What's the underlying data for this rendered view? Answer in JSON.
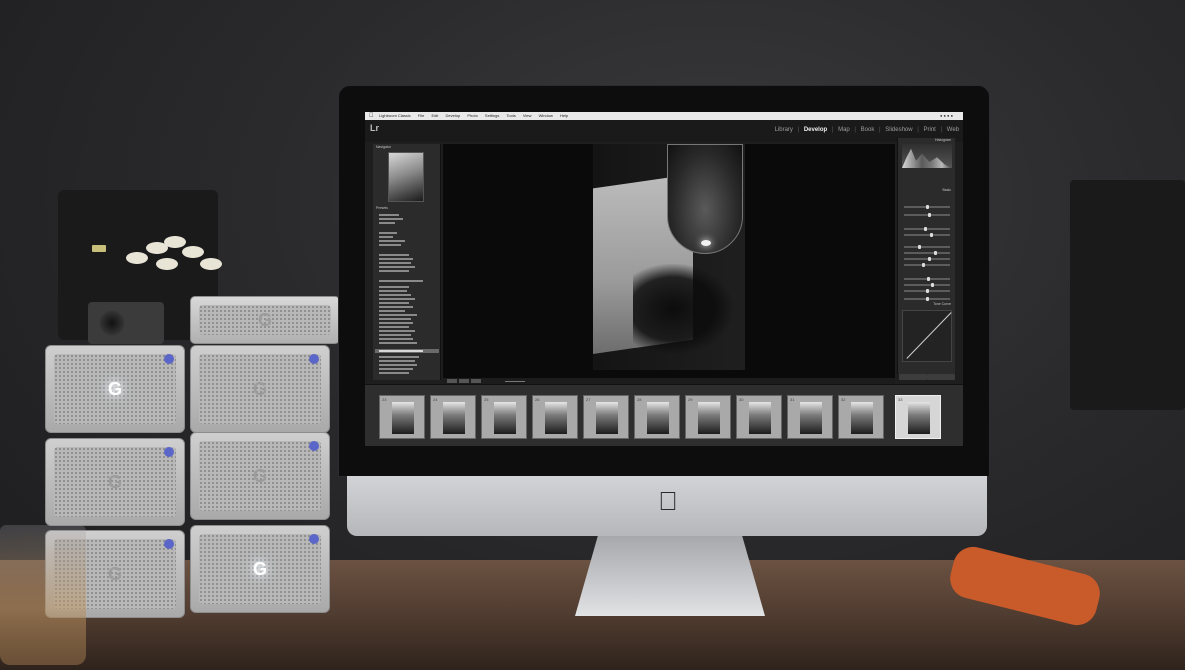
{
  "menubar": {
    "items": [
      "Lightroom Classic",
      "File",
      "Edit",
      "Develop",
      "Photo",
      "Settings",
      "Tools",
      "View",
      "Window",
      "Help"
    ]
  },
  "lightroom": {
    "logo": "Lr",
    "modules": [
      {
        "label": "Library",
        "active": false
      },
      {
        "label": "Develop",
        "active": true
      },
      {
        "label": "Map",
        "active": false
      },
      {
        "label": "Book",
        "active": false
      },
      {
        "label": "Print",
        "active": false
      },
      {
        "label": "Slideshow",
        "active": false
      },
      {
        "label": "Web",
        "active": false
      }
    ],
    "left_panel": {
      "navigator_title": "Navigator",
      "presets_title": "Presets"
    },
    "right_panel": {
      "histogram_title": "Histogram",
      "basic_title": "Basic",
      "tone_curve_title": "Tone Curve"
    },
    "filmstrip": {
      "frame_numbers": [
        "23",
        "24",
        "25",
        "26",
        "27",
        "28",
        "29",
        "30",
        "31",
        "32",
        "33"
      ],
      "selected_index": 10
    }
  },
  "scene": {
    "drive_logo": "G",
    "apple_logo": ""
  },
  "colors": {
    "drive_dot": "#5a66c8",
    "desk": "#6b5242",
    "orange_cable": "#c95a2a"
  }
}
